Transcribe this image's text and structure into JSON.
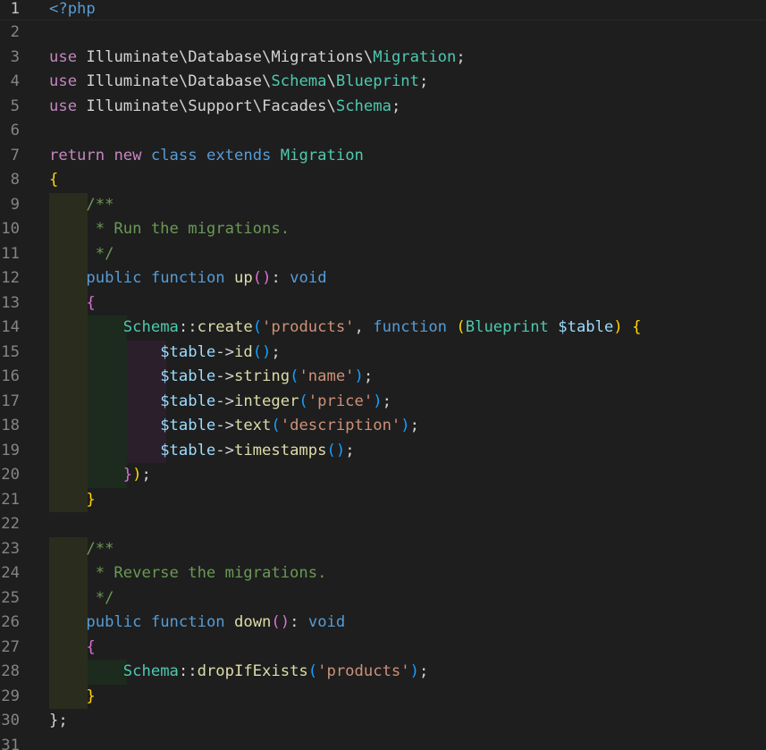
{
  "editor": {
    "language": "php",
    "line_numbers": [
      "1",
      "2",
      "3",
      "4",
      "5",
      "6",
      "7",
      "8",
      "9",
      "10",
      "11",
      "12",
      "13",
      "14",
      "15",
      "16",
      "17",
      "18",
      "19",
      "20",
      "21",
      "22",
      "23",
      "24",
      "25",
      "26",
      "27",
      "28",
      "29",
      "30",
      "31"
    ],
    "active_line": "1",
    "lines": [
      "<?php",
      "",
      "use Illuminate\\Database\\Migrations\\Migration;",
      "use Illuminate\\Database\\Schema\\Blueprint;",
      "use Illuminate\\Support\\Facades\\Schema;",
      "",
      "return new class extends Migration",
      "{",
      "    /**",
      "     * Run the migrations.",
      "     */",
      "    public function up(): void",
      "    {",
      "        Schema::create('products', function (Blueprint $table) {",
      "            $table->id();",
      "            $table->string('name');",
      "            $table->integer('price');",
      "            $table->text('description');",
      "            $table->timestamps();",
      "        });",
      "    }",
      "",
      "    /**",
      "     * Reverse the migrations.",
      "     */",
      "    public function down(): void",
      "    {",
      "        Schema::dropIfExists('products');",
      "    }",
      "};",
      ""
    ]
  },
  "theme": {
    "background": "#1e1e1e",
    "keyword_control": "#c586c0",
    "keyword": "#569cd6",
    "type": "#4ec9b0",
    "function": "#dcdcaa",
    "variable": "#9cdcfe",
    "string": "#ce9178",
    "comment": "#6a9955",
    "bracket_level1": "#ffd700",
    "bracket_level2": "#da70d6",
    "bracket_level3": "#179fff"
  }
}
